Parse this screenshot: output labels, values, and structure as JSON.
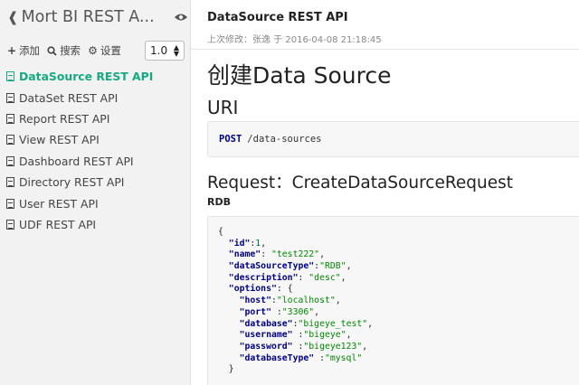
{
  "sidebar": {
    "title": "Mort BI REST A...",
    "tools": {
      "add": "添加",
      "search": "搜索",
      "settings": "设置"
    },
    "version": "1.0",
    "items": [
      {
        "label": "DataSource REST API",
        "active": true
      },
      {
        "label": "DataSet REST API",
        "active": false
      },
      {
        "label": "Report REST API",
        "active": false
      },
      {
        "label": "View REST API",
        "active": false
      },
      {
        "label": "Dashboard REST API",
        "active": false
      },
      {
        "label": "Directory REST API",
        "active": false
      },
      {
        "label": "User REST API",
        "active": false
      },
      {
        "label": "UDF REST API",
        "active": false
      }
    ]
  },
  "main": {
    "doc_title": "DataSource REST API",
    "meta": "上次修改：张逸 于 2016-04-08 21:18:45",
    "h1": "创建Data Source",
    "uri_heading": "URI",
    "uri": {
      "method": "POST",
      "path": "/data-sources"
    },
    "request_heading": "Request：CreateDataSourceRequest",
    "rdb_heading": "RDB",
    "code": [
      {
        "indent": "",
        "open": "{"
      },
      {
        "indent": "  ",
        "key": "\"id\"",
        "sep": ":",
        "num": "1",
        "tail": ","
      },
      {
        "indent": "  ",
        "key": "\"name\"",
        "sep": ": ",
        "val": "\"test222\"",
        "tail": ","
      },
      {
        "indent": "  ",
        "key": "\"dataSourceType\"",
        "sep": ":",
        "val": "\"RDB\"",
        "tail": ","
      },
      {
        "indent": "  ",
        "key": "\"description\"",
        "sep": ": ",
        "val": "\"desc\"",
        "tail": ","
      },
      {
        "indent": "  ",
        "key": "\"options\"",
        "sep": ": ",
        "tail": "{"
      },
      {
        "indent": "    ",
        "key": "\"host\"",
        "sep": ":",
        "val": "\"localhost\"",
        "tail": ","
      },
      {
        "indent": "    ",
        "key": "\"port\"",
        "sep": " :",
        "val": "\"3306\"",
        "tail": ","
      },
      {
        "indent": "    ",
        "key": "\"database\"",
        "sep": ":",
        "val": "\"bigeye_test\"",
        "tail": ","
      },
      {
        "indent": "    ",
        "key": "\"username\"",
        "sep": " :",
        "val": "\"bigeye\"",
        "tail": ","
      },
      {
        "indent": "    ",
        "key": "\"password\"",
        "sep": " :",
        "val": "\"bigeye123\"",
        "tail": ","
      },
      {
        "indent": "    ",
        "key": "\"databaseType\"",
        "sep": " :",
        "val": "\"mysql\"",
        "tail": ""
      },
      {
        "indent": "  ",
        "open": "}"
      }
    ]
  },
  "colors": {
    "accent": "#17a982",
    "keyword": "#000088",
    "string": "#008800",
    "number": "#006666"
  },
  "icons": [
    "back-arrow-icon",
    "eye-icon",
    "plus-icon",
    "search-icon",
    "gear-icon",
    "document-icon"
  ]
}
